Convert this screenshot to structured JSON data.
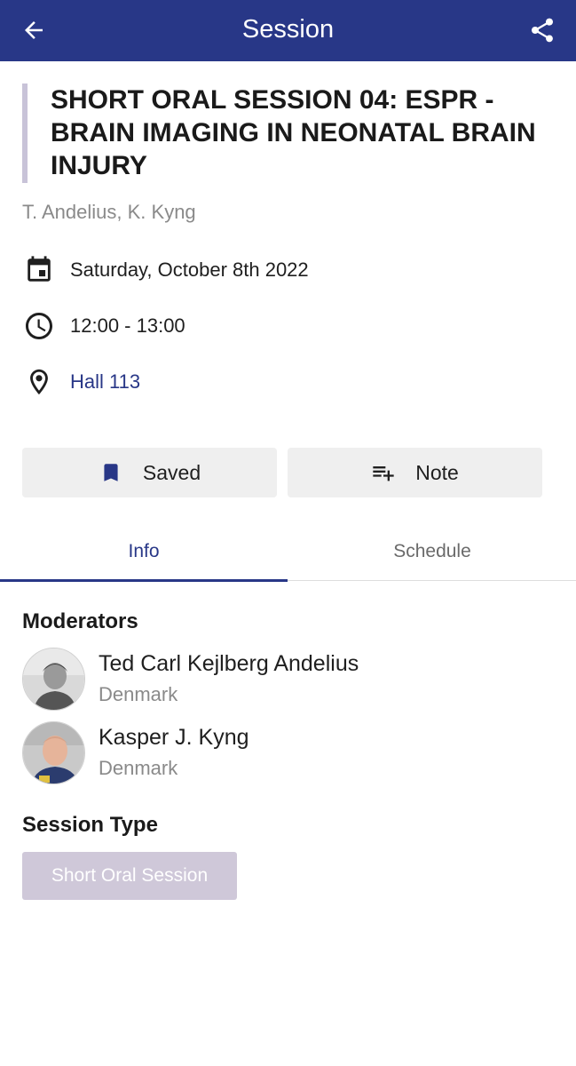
{
  "appbar": {
    "title": "Session",
    "back_icon": "arrow-left-icon",
    "share_icon": "share-icon",
    "background": "#283787"
  },
  "session": {
    "title": "SHORT ORAL SESSION 04: ESPR - BRAIN IMAGING IN NEONATAL BRAIN INJURY",
    "authors": "T. Andelius, K. Kyng",
    "date": "Saturday, October 8th 2022",
    "time": "12:00 - 13:00",
    "location": "Hall 113"
  },
  "actions": {
    "saved_label": "Saved",
    "note_label": "Note"
  },
  "tabs": [
    {
      "label": "Info",
      "active": true
    },
    {
      "label": "Schedule",
      "active": false
    }
  ],
  "moderators": {
    "heading": "Moderators",
    "people": [
      {
        "name": "Ted Carl Kejlberg Andelius",
        "country": "Denmark"
      },
      {
        "name": "Kasper J. Kyng",
        "country": "Denmark"
      }
    ]
  },
  "session_type": {
    "heading": "Session Type",
    "value": "Short Oral Session",
    "badge_color": "#cfc8d9"
  }
}
